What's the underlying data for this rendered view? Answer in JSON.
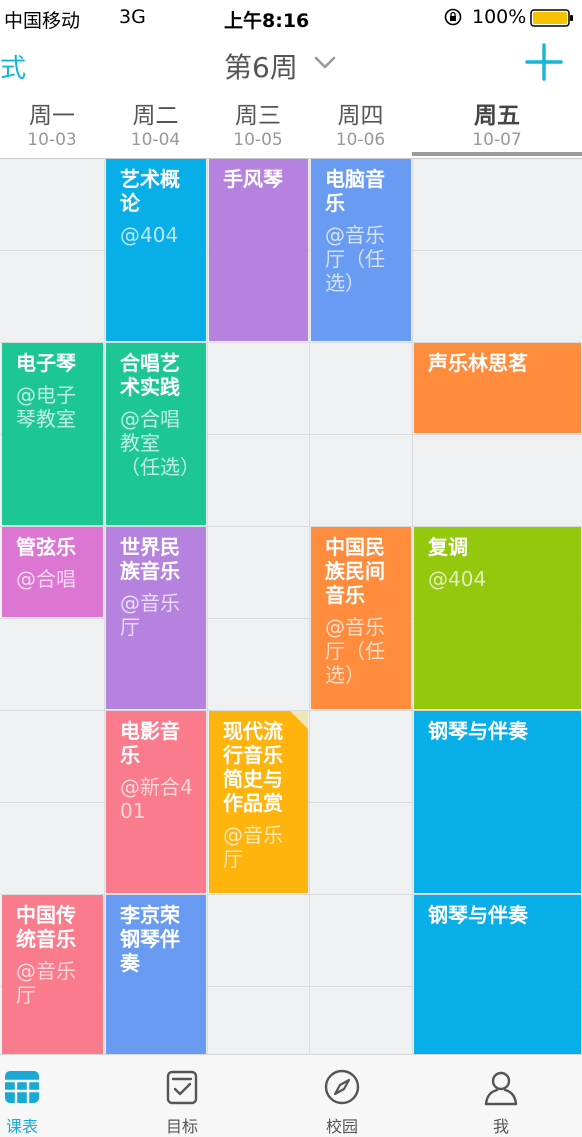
{
  "status_bar": {
    "carrier": "中国移动",
    "network": "3G",
    "time": "上午8:16",
    "battery": "100%",
    "lock_icon": "orientation-lock-icon",
    "battery_icon": "battery-icon"
  },
  "header": {
    "left_label": "式",
    "week_title": "第6周",
    "chevron_icon": "chevron-down-icon",
    "add_icon": "plus-icon",
    "accent_color": "#12b6d6"
  },
  "days": [
    {
      "name": "周一",
      "date": "10-03"
    },
    {
      "name": "周二",
      "date": "10-04"
    },
    {
      "name": "周三",
      "date": "10-05"
    },
    {
      "name": "周四",
      "date": "10-06"
    },
    {
      "name": "周五",
      "date": "10-07"
    }
  ],
  "active_day": "周五",
  "courses": [
    {
      "day": "周二",
      "start": 1,
      "span": 2,
      "name": "艺术概论",
      "room": "@404",
      "color": "#08aee8"
    },
    {
      "day": "周三",
      "start": 1,
      "span": 2,
      "name": "手风琴",
      "room": "",
      "color": "#b583df"
    },
    {
      "day": "周四",
      "start": 1,
      "span": 2,
      "name": "电脑音乐",
      "room": "@音乐厅（任选）",
      "color": "#6a9bf2"
    },
    {
      "day": "周一",
      "start": 3,
      "span": 2,
      "name": "电子琴",
      "room": "@电子琴教室",
      "color": "#1dc794"
    },
    {
      "day": "周二",
      "start": 3,
      "span": 2,
      "name": "合唱艺术实践",
      "room": "@合唱教室（任选）",
      "color": "#1dc794"
    },
    {
      "day": "周五",
      "start": 3,
      "span": 1,
      "name": "声乐林思茗",
      "room": "",
      "color": "#ff8b3d"
    },
    {
      "day": "周一",
      "start": 5,
      "span": 1,
      "name": "管弦乐",
      "room": "@合唱",
      "color": "#dc76d2"
    },
    {
      "day": "周二",
      "start": 5,
      "span": 2,
      "name": "世界民族音乐",
      "room": "@音乐厅",
      "color": "#b583df"
    },
    {
      "day": "周四",
      "start": 5,
      "span": 2,
      "name": "中国民族民间音乐",
      "room": "@音乐厅（任选）",
      "color": "#ff8b3d"
    },
    {
      "day": "周五",
      "start": 5,
      "span": 2,
      "name": "复调",
      "room": "@404",
      "color": "#93c80d"
    },
    {
      "day": "周二",
      "start": 7,
      "span": 2,
      "name": "电影音乐",
      "room": "@新合401",
      "color": "#fa7b8c"
    },
    {
      "day": "周三",
      "start": 7,
      "span": 2,
      "name": "现代流行音乐简史与作品赏",
      "room": "@音乐厅",
      "color": "#ffb30d",
      "folded": true
    },
    {
      "day": "周五",
      "start": 7,
      "span": 2,
      "name": "钢琴与伴奏",
      "room": "",
      "color": "#08aee8"
    },
    {
      "day": "周一",
      "start": 9,
      "span": 2,
      "name": "中国传统音乐",
      "room": "@音乐厅",
      "color": "#fa7b8c"
    },
    {
      "day": "周二",
      "start": 9,
      "span": 2,
      "name": "李京荣钢琴伴奏",
      "room": "",
      "color": "#6a9bf2"
    },
    {
      "day": "周五",
      "start": 9,
      "span": 2,
      "name": "钢琴与伴奏",
      "room": "",
      "color": "#08aee8"
    }
  ],
  "tabs": [
    {
      "label": "课表",
      "icon": "schedule-grid-icon",
      "active": true
    },
    {
      "label": "目标",
      "icon": "target-checklist-icon",
      "active": false
    },
    {
      "label": "校园",
      "icon": "compass-icon",
      "active": false
    },
    {
      "label": "我",
      "icon": "user-icon",
      "active": false
    }
  ]
}
